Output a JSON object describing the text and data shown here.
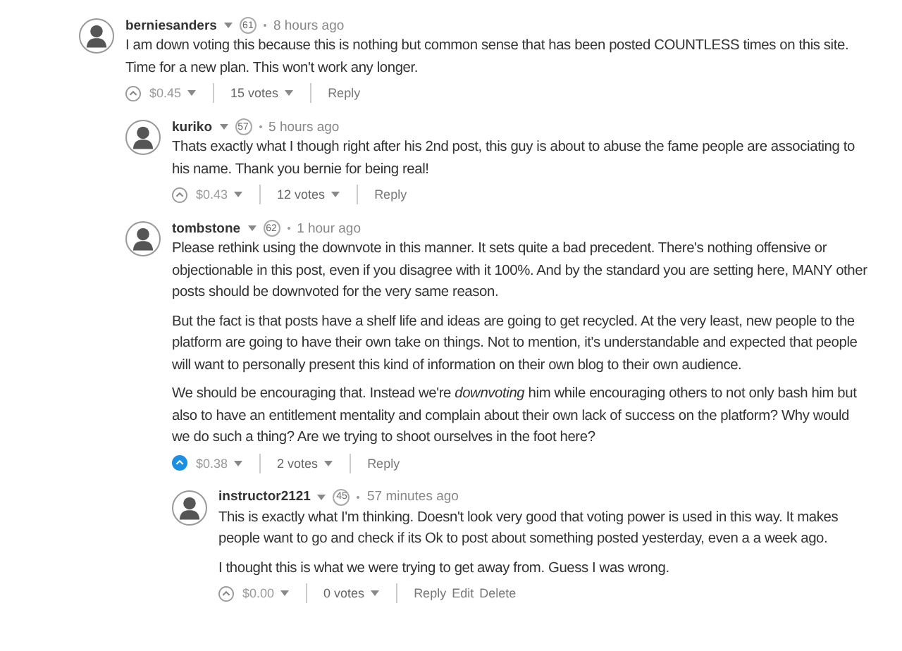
{
  "comments": [
    {
      "author": "berniesanders",
      "reputation": "61",
      "time": "8 hours ago",
      "paragraphs": [
        "I am down voting this because this is nothing but common sense that has been posted COUNTLESS times on this site. Time for a new plan. This won't work any longer."
      ],
      "upvoted": false,
      "payout": "$0.45",
      "votes": "15 votes",
      "actions": [
        "Reply"
      ],
      "children": [
        {
          "author": "kuriko",
          "reputation": "57",
          "time": "5 hours ago",
          "paragraphs": [
            "Thats exactly what I though right after his 2nd post, this guy is about to abuse the fame people are associating to his name. Thank you bernie for being real!"
          ],
          "upvoted": false,
          "payout": "$0.43",
          "votes": "12 votes",
          "actions": [
            "Reply"
          ]
        },
        {
          "author": "tombstone",
          "reputation": "62",
          "time": "1 hour ago",
          "paragraphs": [
            "Please rethink using the downvote in this manner. It sets quite a bad precedent. There's nothing offensive or objectionable in this post, even if you disagree with it 100%. And by the standard you are setting here, MANY other posts should be downvoted for the very same reason.",
            "But the fact is that posts have a shelf life and ideas are going to get recycled. At the very least, new people to the platform are going to have their own take on things. Not to mention, it's understandable and expected that people will want to personally present this kind of information on their own blog to their own audience.",
            "We should be encouraging that. Instead we're *downvoting* him while encouraging others to not only bash him but also to have an entitlement mentality and complain about their own lack of success on the platform? Why would we do such a thing? Are we trying to shoot ourselves in the foot here?"
          ],
          "upvoted": true,
          "payout": "$0.38",
          "votes": "2 votes",
          "actions": [
            "Reply"
          ],
          "children": [
            {
              "author": "instructor2121",
              "reputation": "45",
              "time": "57 minutes ago",
              "paragraphs": [
                "This is exactly what I'm thinking. Doesn't look very good that voting power is used in this way. It makes people want to go and check if its Ok to post about something posted yesterday, even a a week ago.",
                "I thought this is what we were trying to get away from. Guess I was wrong."
              ],
              "upvoted": false,
              "payout": "$0.00",
              "votes": "0 votes",
              "actions": [
                "Reply",
                "Edit",
                "Delete"
              ]
            }
          ]
        }
      ]
    }
  ]
}
